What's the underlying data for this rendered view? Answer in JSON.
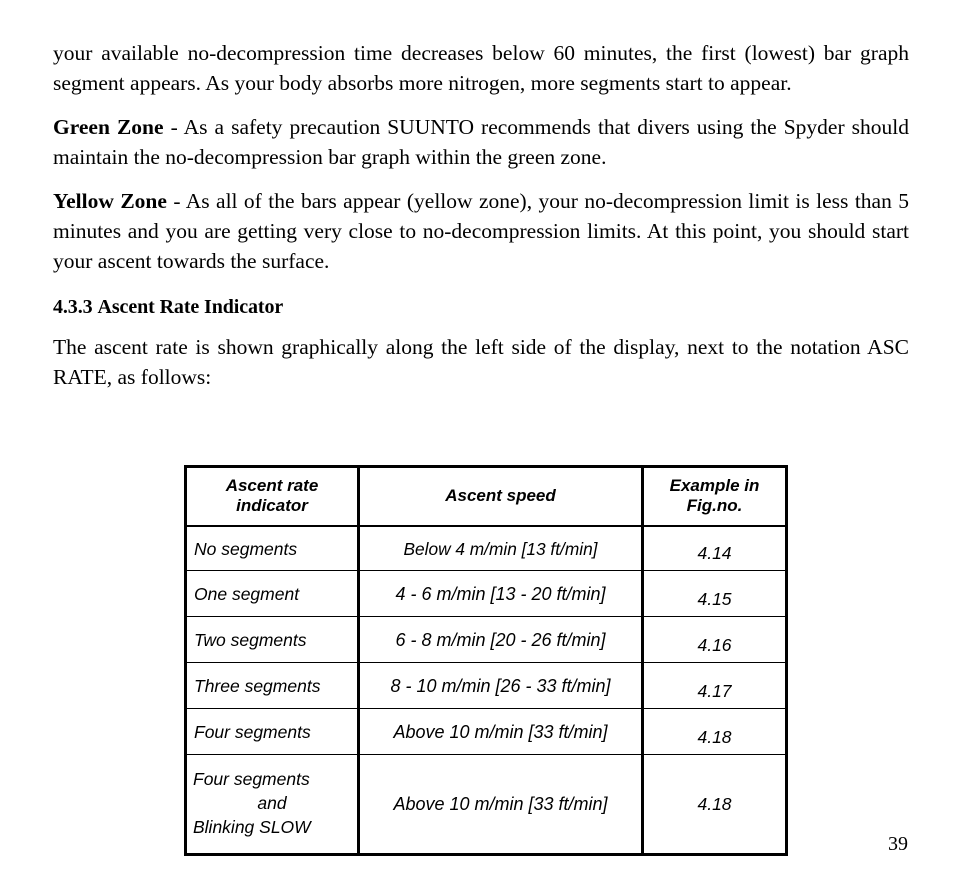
{
  "page": {
    "number": "39"
  },
  "body": {
    "paragraph_1": "your available no-decompression time decreases below 60 minutes, the first (lowest) bar graph segment appears. As your body absorbs more nitrogen, more segments start to appear.",
    "paragraph_2_lead": "Green Zone",
    "paragraph_2_rest": " - As a safety precaution SUUNTO recommends that divers using the Spyder should maintain the no-decompression bar graph within the green zone.",
    "paragraph_3_lead": "Yellow Zone",
    "paragraph_3_rest": " - As all of the bars appear (yellow zone), your no-decompression limit is less than 5 minutes and you are getting very close to no-decompression limits. At this point, you should start your ascent towards the surface.",
    "heading_number": "4.3.3",
    "heading_title": "Ascent Rate Indicator",
    "paragraph_4": "The ascent rate is shown graphically along the left side of the display, next to the notation ASC RATE, as follows:"
  },
  "table": {
    "headers": {
      "col1_line1": "Ascent rate",
      "col1_line2": "indicator",
      "col2": "Ascent speed",
      "col3_line1": "Example in",
      "col3_line2": "Fig.no."
    },
    "rows": [
      {
        "indicator": "No segments",
        "speed": "Below 4 m/min [13 ft/min]",
        "figure": "4.14"
      },
      {
        "indicator": "One segment",
        "speed": "4 - 6 m/min [13 - 20 ft/min]",
        "figure": "4.15"
      },
      {
        "indicator": "Two segments",
        "speed": "6 - 8 m/min [20 - 26 ft/min]",
        "figure": "4.16"
      },
      {
        "indicator": "Three segments",
        "speed": "8 - 10 m/min [26 - 33 ft/min]",
        "figure": "4.17"
      },
      {
        "indicator": "Four segments",
        "speed": "Above 10 m/min [33 ft/min]",
        "figure": "4.18"
      }
    ],
    "last_row": {
      "indicator_line1": "Four segments",
      "indicator_line2": "and",
      "indicator_line3": "Blinking SLOW",
      "speed": "Above 10 m/min [33 ft/min]",
      "figure": "4.18"
    }
  }
}
